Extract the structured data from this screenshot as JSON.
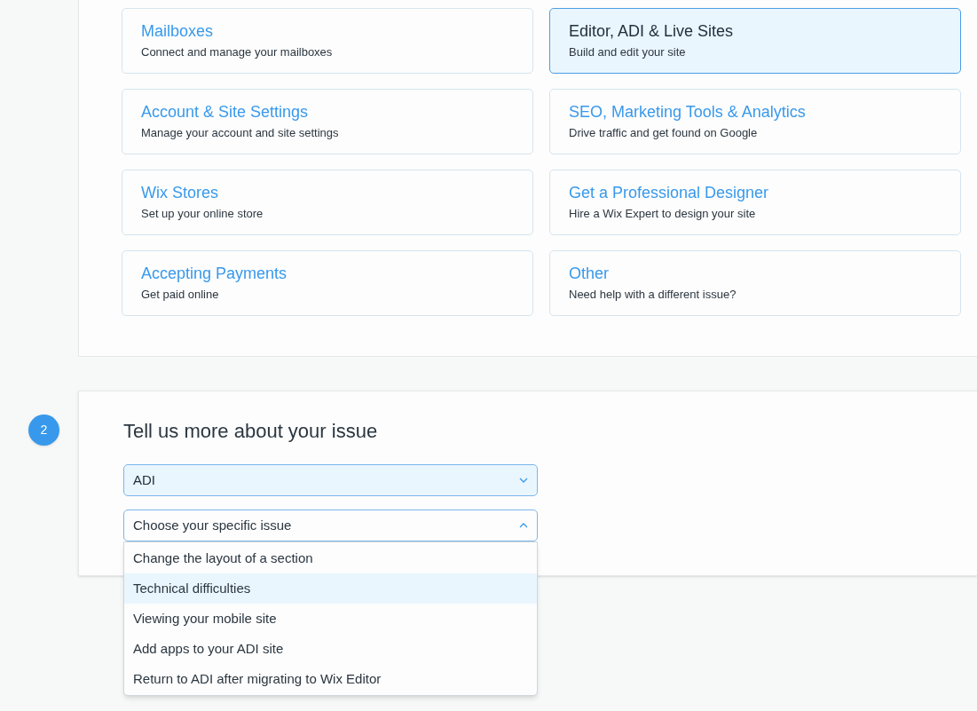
{
  "categories": [
    {
      "title": "Mailboxes",
      "description": "Connect and manage your mailboxes",
      "selected": false
    },
    {
      "title": "Editor, ADI & Live Sites",
      "description": "Build and edit your site",
      "selected": true
    },
    {
      "title": "Account & Site Settings",
      "description": "Manage your account and site settings",
      "selected": false
    },
    {
      "title": "SEO, Marketing Tools & Analytics",
      "description": "Drive traffic and get found on Google",
      "selected": false
    },
    {
      "title": "Wix Stores",
      "description": "Set up your online store",
      "selected": false
    },
    {
      "title": "Get a Professional Designer",
      "description": "Hire a Wix Expert to design your site",
      "selected": false
    },
    {
      "title": "Accepting Payments",
      "description": "Get paid online",
      "selected": false
    },
    {
      "title": "Other",
      "description": "Need help with a different issue?",
      "selected": false
    }
  ],
  "step": {
    "number": "2",
    "heading": "Tell us more about your issue"
  },
  "product_select": {
    "value": "ADI"
  },
  "issue_select": {
    "placeholder": "Choose your specific issue",
    "expanded": true,
    "options": [
      {
        "label": "Change the layout of a section",
        "selected": false
      },
      {
        "label": "Technical difficulties",
        "selected": true
      },
      {
        "label": "Viewing your mobile site",
        "selected": false
      },
      {
        "label": "Add apps to your ADI site",
        "selected": false
      },
      {
        "label": "Return to ADI after migrating to Wix Editor",
        "selected": false
      }
    ]
  }
}
